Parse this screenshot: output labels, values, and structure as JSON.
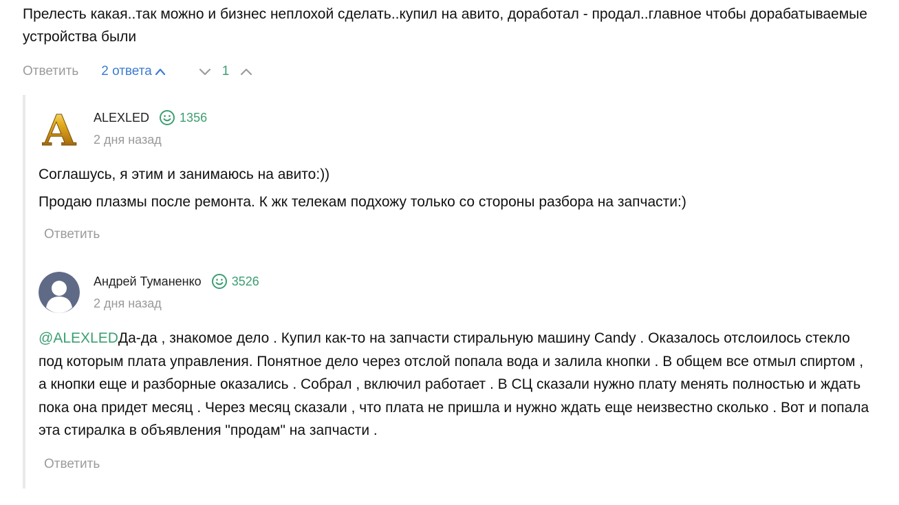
{
  "parent_comment": {
    "text": "Прелесть какая..так можно и бизнес неплохой сделать..купил на авито, доработал - продал..главное чтобы дорабатываемые устройства были",
    "reply_label": "Ответить",
    "replies_toggle_label": "2 ответа",
    "score": "1"
  },
  "replies": [
    {
      "author": "ALEXLED",
      "avatar_letter": "A",
      "karma": "1356",
      "time": "2 дня назад",
      "lines": [
        "Соглашусь, я этим и занимаюсь на авито:))",
        "Продаю плазмы после ремонта. К жк телекам подхожу только со стороны разбора на запчасти:)"
      ],
      "reply_label": "Ответить"
    },
    {
      "author": "Андрей Туманенко",
      "karma": "3526",
      "time": "2 дня назад",
      "mention": "@ALEXLED",
      "text": "Да-да , знакомое дело . Купил как-то на запчасти стиральную машину Candy . Оказалось отслоилось стекло под которым плата управления. Понятное дело через отслой попала вода и залила кнопки . В общем все отмыл спиртом , а кнопки еще и разборные оказались . Собрал , включил работает . В СЦ сказали нужно плату менять полностью и ждать пока она придет месяц . Через месяц сказали , что плата не пришла и нужно ждать еще неизвестно сколько . Вот и попала эта стиралка в объявления \"продам\" на запчасти .",
      "reply_label": "Ответить"
    }
  ],
  "colors": {
    "accent_green": "#3b9e72",
    "link_blue": "#3c7bd1",
    "muted_gray": "#9b9b9b",
    "thread_line": "#eaeaea"
  },
  "icons": [
    "chevron-up-icon",
    "chevron-down-icon",
    "smile-karma-icon",
    "user-avatar-placeholder"
  ]
}
